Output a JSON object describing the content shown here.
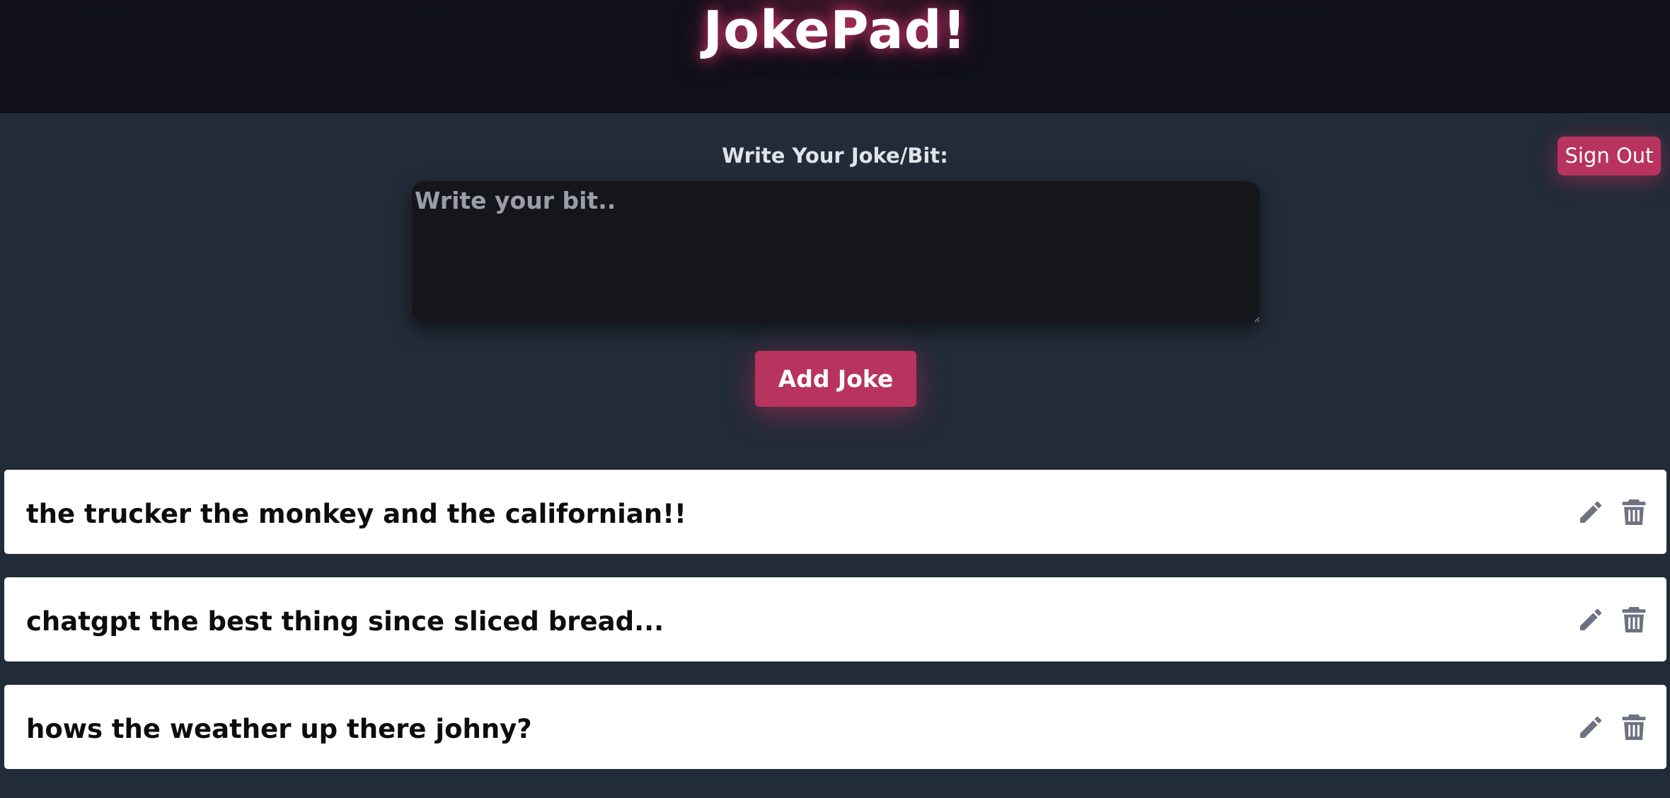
{
  "header": {
    "title": "JokePad!"
  },
  "auth": {
    "sign_out_label": "Sign Out"
  },
  "composer": {
    "label": "Write Your Joke/Bit:",
    "placeholder": "Write your bit..",
    "value": "",
    "submit_label": "Add Joke"
  },
  "jokes": [
    {
      "text": "the trucker the monkey and the californian!!"
    },
    {
      "text": "chatgpt the best thing since sliced bread..."
    },
    {
      "text": "hows the weather up there johny?"
    }
  ],
  "colors": {
    "accent": "#b8335e",
    "background": "#222b38",
    "header_background": "#101018",
    "icon": "#6e7280"
  },
  "icons": {
    "edit": "pencil-icon",
    "delete": "trash-icon"
  }
}
